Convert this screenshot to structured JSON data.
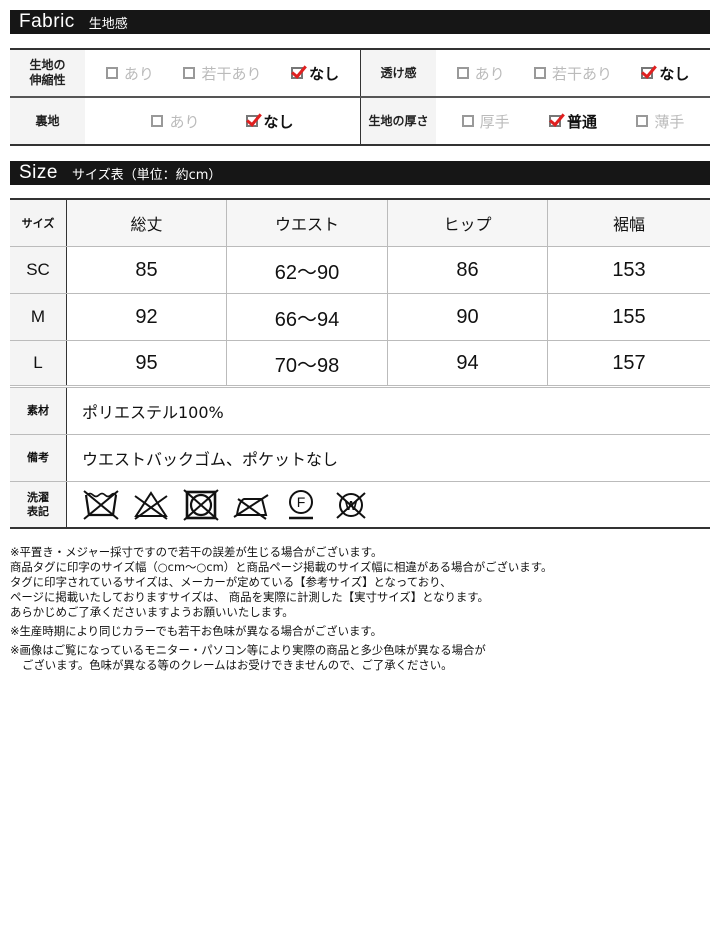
{
  "fabric_section": {
    "title_en": "Fabric",
    "title_jp": "生地感",
    "rows": [
      [
        {
          "label_lines": [
            "生地の",
            "伸縮性"
          ],
          "options": [
            {
              "label": "あり",
              "checked": false
            },
            {
              "label": "若干あり",
              "checked": false
            },
            {
              "label": "なし",
              "checked": true
            }
          ]
        },
        {
          "label_lines": [
            "透け感"
          ],
          "options": [
            {
              "label": "あり",
              "checked": false
            },
            {
              "label": "若干あり",
              "checked": false
            },
            {
              "label": "なし",
              "checked": true
            }
          ]
        }
      ],
      [
        {
          "label_lines": [
            "裏地"
          ],
          "options": [
            {
              "label": "あり",
              "checked": false
            },
            {
              "label": "なし",
              "checked": true
            }
          ]
        },
        {
          "label_lines": [
            "生地の厚さ"
          ],
          "options": [
            {
              "label": "厚手",
              "checked": false
            },
            {
              "label": "普通",
              "checked": true
            },
            {
              "label": "薄手",
              "checked": false
            }
          ]
        }
      ]
    ],
    "check_color": "#e02020"
  },
  "size_section": {
    "title_en": "Size",
    "title_jp": "サイズ表（単位：約cm）",
    "columns": [
      "サイズ",
      "総丈",
      "ウエスト",
      "ヒップ",
      "裾幅"
    ],
    "rows": [
      [
        "SC",
        "85",
        "62〜90",
        "86",
        "153"
      ],
      [
        "M",
        "92",
        "66〜94",
        "90",
        "155"
      ],
      [
        "L",
        "95",
        "70〜98",
        "94",
        "157"
      ]
    ],
    "material_label": "素材",
    "material_value": "ポリエステル100%",
    "remarks_label": "備考",
    "remarks_value": "ウエストバックゴム、ポケットなし",
    "care_label_lines": [
      "洗濯",
      "表記"
    ],
    "care_icons": [
      "no-wash-icon",
      "no-bleach-icon",
      "no-tumble-dry-icon",
      "no-iron-icon",
      "dry-clean-f-icon",
      "no-wet-clean-icon"
    ]
  },
  "notes": [
    "※平置き・メジャー採寸ですので若干の誤差が生じる場合がございます。",
    "商品タグに印字のサイズ幅（○cm〜○cm）と商品ページ掲載のサイズ幅に相違がある場合がございます。",
    "タグに印字されているサイズは、メーカーが定めている【参考サイズ】となっており、",
    "ページに掲載いたしておりますサイズは、 商品を実際に計測した【実寸サイズ】となります。",
    "あらかじめご了承くださいますようお願いいたします。",
    "※生産時期により同じカラーでも若干お色味が異なる場合がございます。",
    "※画像はご覧になっているモニター・パソコン等により実際の商品と多少色味が異なる場合が",
    "ございます。色味が異なる等のクレームはお受けできませんので、ご了承ください。"
  ]
}
